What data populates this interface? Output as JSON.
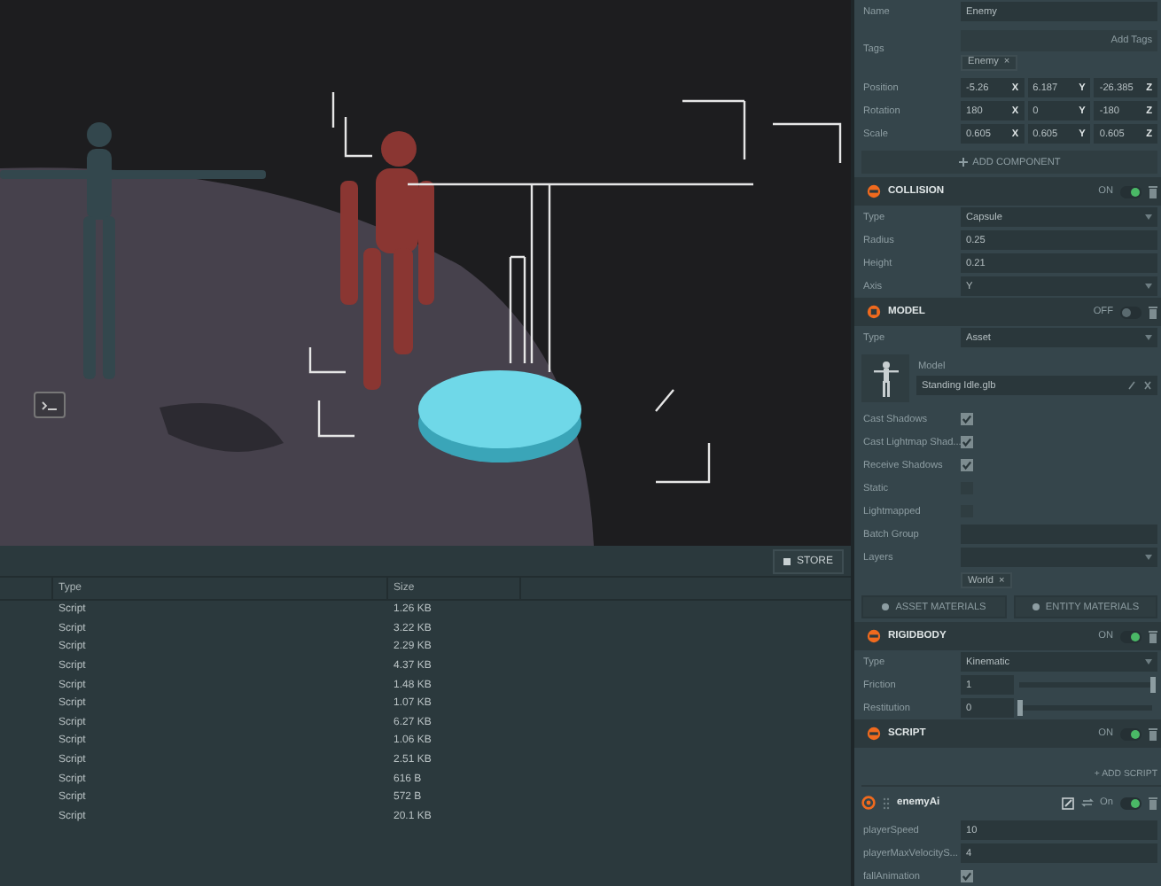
{
  "assets": {
    "store_button": "STORE",
    "columns": [
      "Type",
      "Size"
    ],
    "rows": [
      {
        "type": "Script",
        "size": "1.26 KB"
      },
      {
        "type": "Script",
        "size": "3.22 KB"
      },
      {
        "type": "Script",
        "size": "2.29 KB"
      },
      {
        "type": "Script",
        "size": "4.37 KB"
      },
      {
        "type": "Script",
        "size": "1.48 KB"
      },
      {
        "type": "Script",
        "size": "1.07 KB"
      },
      {
        "type": "Script",
        "size": "6.27 KB"
      },
      {
        "type": "Script",
        "size": "1.06 KB"
      },
      {
        "type": "Script",
        "size": "2.51 KB"
      },
      {
        "type": "Script",
        "size": "616 B"
      },
      {
        "type": "Script",
        "size": "572 B"
      },
      {
        "type": "Script",
        "size": "20.1 KB"
      }
    ]
  },
  "inspector": {
    "name": {
      "label": "Name",
      "value": "Enemy"
    },
    "tags": {
      "label": "Tags",
      "placeholder": "Add Tags",
      "chips": [
        "Enemy"
      ],
      "remove": "×"
    },
    "vectors": [
      {
        "label": "Position",
        "values": [
          {
            "value": "-5.26",
            "axis": "X"
          },
          {
            "value": "6.187",
            "axis": "Y"
          },
          {
            "value": "-26.385",
            "axis": "Z"
          }
        ]
      },
      {
        "label": "Rotation",
        "values": [
          {
            "value": "180",
            "axis": "X"
          },
          {
            "value": "0",
            "axis": "Y"
          },
          {
            "value": "-180",
            "axis": "Z"
          }
        ]
      },
      {
        "label": "Scale",
        "values": [
          {
            "value": "0.605",
            "axis": "X"
          },
          {
            "value": "0.605",
            "axis": "Y"
          },
          {
            "value": "0.605",
            "axis": "Z"
          }
        ]
      }
    ],
    "add_component": "ADD COMPONENT",
    "components": [
      {
        "title": "COLLISION",
        "enabled": true,
        "toggle_label": "ON",
        "rows": [
          {
            "kind": "select",
            "label": "Type",
            "value": "Capsule"
          },
          {
            "kind": "text",
            "label": "Radius",
            "value": "0.25"
          },
          {
            "kind": "text",
            "label": "Height",
            "value": "0.21"
          },
          {
            "kind": "select",
            "label": "Axis",
            "value": "Y"
          }
        ]
      },
      {
        "title": "MODEL",
        "enabled": false,
        "toggle_label": "OFF",
        "rows": [
          {
            "kind": "select",
            "label": "Type",
            "value": "Asset"
          },
          {
            "kind": "asset",
            "label": "Model",
            "value": "Standing Idle.glb"
          },
          {
            "kind": "checkbox",
            "label": "Cast Shadows",
            "checked": true
          },
          {
            "kind": "checkbox",
            "label": "Cast Lightmap Shad...",
            "checked": true
          },
          {
            "kind": "checkbox",
            "label": "Receive Shadows",
            "checked": true
          },
          {
            "kind": "checkbox",
            "label": "Static",
            "checked": false
          },
          {
            "kind": "checkbox",
            "label": "Lightmapped",
            "checked": false
          },
          {
            "kind": "text",
            "label": "Batch Group",
            "value": ""
          },
          {
            "kind": "select",
            "label": "Layers",
            "value": ""
          },
          {
            "kind": "chips",
            "chips": [
              "World"
            ],
            "remove": "×"
          },
          {
            "kind": "buttons",
            "buttons": [
              "ASSET MATERIALS",
              "ENTITY MATERIALS"
            ]
          }
        ]
      },
      {
        "title": "RIGIDBODY",
        "enabled": true,
        "toggle_label": "ON",
        "rows": [
          {
            "kind": "select",
            "label": "Type",
            "value": "Kinematic"
          },
          {
            "kind": "slider",
            "label": "Friction",
            "value": "1",
            "level": 1
          },
          {
            "kind": "slider",
            "label": "Restitution",
            "value": "0",
            "level": 0
          }
        ]
      },
      {
        "title": "SCRIPT",
        "enabled": true,
        "toggle_label": "ON",
        "rows": [
          {
            "kind": "add",
            "value": "+ ADD SCRIPT"
          },
          {
            "kind": "script",
            "value": "enemyAi",
            "enabled": true,
            "toggle_label": "On"
          },
          {
            "kind": "text",
            "label": "playerSpeed",
            "value": "10"
          },
          {
            "kind": "text",
            "label": "playerMaxVelocityS...",
            "value": "4"
          },
          {
            "kind": "checkbox",
            "label": "fallAnimation",
            "checked": true
          }
        ]
      }
    ]
  }
}
